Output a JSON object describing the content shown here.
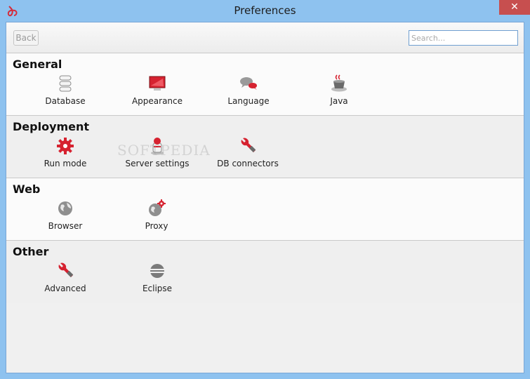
{
  "window": {
    "title": "Preferences",
    "close_label": "✕"
  },
  "toolbar": {
    "back_label": "Back",
    "search_placeholder": "Search..."
  },
  "sections": [
    {
      "title": "General",
      "items": [
        {
          "label": "Database"
        },
        {
          "label": "Appearance"
        },
        {
          "label": "Language"
        },
        {
          "label": "Java"
        }
      ]
    },
    {
      "title": "Deployment",
      "items": [
        {
          "label": "Run mode"
        },
        {
          "label": "Server settings"
        },
        {
          "label": "DB connectors"
        }
      ]
    },
    {
      "title": "Web",
      "items": [
        {
          "label": "Browser"
        },
        {
          "label": "Proxy"
        }
      ]
    },
    {
      "title": "Other",
      "items": [
        {
          "label": "Advanced"
        },
        {
          "label": "Eclipse"
        }
      ]
    }
  ],
  "icons": {
    "database": "database-icon",
    "appearance": "monitor-icon",
    "language": "speech-bubbles-icon",
    "java": "java-cup-icon",
    "run_mode": "gear-icon",
    "server_settings": "server-icon",
    "db_connectors": "wrench-icon",
    "browser": "globe-icon",
    "proxy": "globe-gear-icon",
    "advanced": "wrench-icon",
    "eclipse": "eclipse-icon"
  },
  "watermark": "SOFTPEDIA",
  "colors": {
    "accent": "#c8202f",
    "titlebar": "#8ec2ef",
    "close": "#c74f4f"
  }
}
